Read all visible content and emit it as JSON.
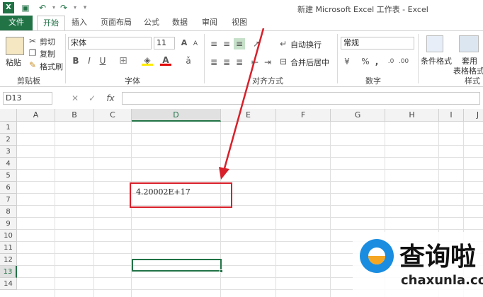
{
  "title": "新建 Microsoft Excel 工作表 - Excel",
  "tabs": [
    "文件",
    "开始",
    "插入",
    "页面布局",
    "公式",
    "数据",
    "审阅",
    "视图"
  ],
  "clipboard": {
    "paste": "粘贴",
    "cut": "剪切",
    "copy": "复制",
    "format_painter": "格式刷",
    "group": "剪贴板"
  },
  "font": {
    "name": "宋体",
    "size": "11",
    "bold": "B",
    "italic": "I",
    "underline": "U",
    "group": "字体"
  },
  "alignment": {
    "wrap": "自动换行",
    "merge": "合并后居中",
    "group": "对齐方式"
  },
  "number": {
    "format": "常规",
    "percent": "%",
    "comma": ",",
    "group": "数字"
  },
  "styles": {
    "conditional": "条件格式",
    "table1": "套用",
    "table2": "表格格式",
    "group": "样式"
  },
  "formula_bar": {
    "name_box": "D13",
    "cancel": "✕",
    "enter": "✓",
    "fx": "fx",
    "value": ""
  },
  "columns": [
    "A",
    "B",
    "C",
    "D",
    "E",
    "F",
    "G",
    "H",
    "I",
    "J"
  ],
  "rows": [
    "1",
    "2",
    "3",
    "4",
    "5",
    "6",
    "7",
    "8",
    "9",
    "10",
    "11",
    "12",
    "13",
    "14"
  ],
  "cells": {
    "D7": "4.20002E+17"
  },
  "selected_cell": "D13",
  "watermark": {
    "text": "查询啦",
    "url": "chaxunla.com"
  },
  "colors": {
    "accent": "#217346",
    "annotation": "#d8202a"
  }
}
